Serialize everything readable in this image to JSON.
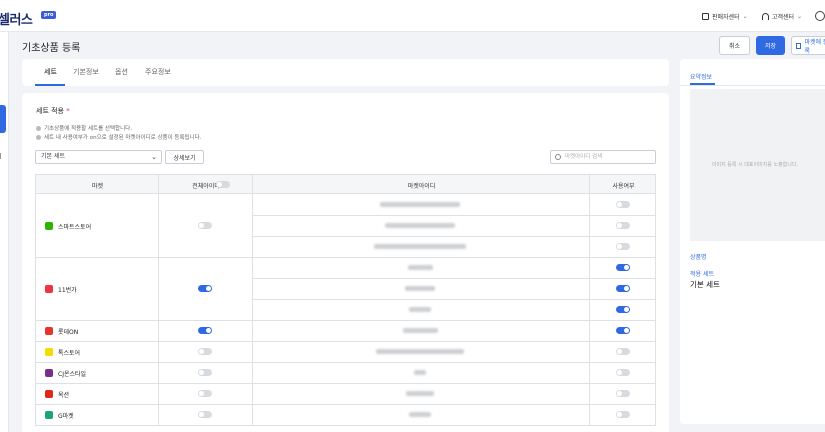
{
  "header": {
    "logo": "셀러스",
    "logo_badge": "pro",
    "menu_seller_center": "판매자센터",
    "menu_customer_center": "고객센터"
  },
  "page": {
    "title": "기초상품 등록",
    "cancel": "취소",
    "save": "저장",
    "market_register": "마켓에 등록"
  },
  "tabs": [
    "세트",
    "기본정보",
    "옵션",
    "주요정보"
  ],
  "set_section": {
    "title": "세트 적용",
    "required_mark": "*",
    "notes": [
      "기초상품에 적용할 세트를 선택합니다.",
      "세트 내 사용여부가 on으로 설정된 마켓아이디로 상품이 등록됩니다."
    ],
    "select_value": "기본 세트",
    "detail_button": "상세보기",
    "search_placeholder": "마켓아이디 검색"
  },
  "table": {
    "headers": {
      "market": "마켓",
      "all_ids": "전체아이디",
      "market_id": "마켓아이디",
      "use": "사용여부"
    },
    "markets": [
      {
        "name": "스마트스토어",
        "icon": "smartstore-icon",
        "color": "#2db400",
        "all_on": false,
        "rows": [
          {
            "on": false
          },
          {
            "on": false
          },
          {
            "on": false
          }
        ]
      },
      {
        "name": "11번가",
        "icon": "11st-icon",
        "color": "#f43142",
        "all_on": true,
        "rows": [
          {
            "on": true
          },
          {
            "on": true
          },
          {
            "on": true
          }
        ]
      },
      {
        "name": "롯데ON",
        "icon": "lotteon-icon",
        "color": "#e8352c",
        "all_on": true,
        "rows": [
          {
            "on": true
          }
        ]
      },
      {
        "name": "톡스토어",
        "icon": "talkstore-icon",
        "color": "#f7d800",
        "all_on": false,
        "rows": [
          {
            "on": false
          }
        ]
      },
      {
        "name": "CJ온스타일",
        "icon": "cjonstyle-icon",
        "color": "#7b2d8e",
        "all_on": false,
        "rows": [
          {
            "on": false
          }
        ]
      },
      {
        "name": "옥션",
        "icon": "auction-icon",
        "color": "#e1261c",
        "all_on": false,
        "rows": [
          {
            "on": false
          }
        ]
      },
      {
        "name": "G마켓",
        "icon": "gmarket-icon",
        "color": "#1aa57a",
        "all_on": false,
        "rows": [
          {
            "on": false
          }
        ]
      }
    ]
  },
  "summary": {
    "tab": "요약정보",
    "image_hint": "이미지 등록 시 대표이미지를 노출합니다.",
    "product_name_label": "상품명",
    "set_label": "적용 세트",
    "set_value": "기본 세트"
  }
}
